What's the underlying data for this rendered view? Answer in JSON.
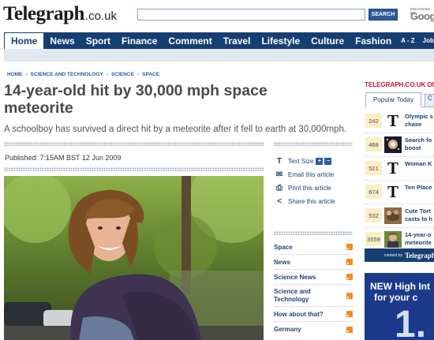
{
  "header": {
    "logo_main": "Telegraph",
    "logo_tld": ".co.uk",
    "search_button": "SEARCH",
    "google_enhanced": "ENHANCED BY",
    "google_logo": "Google"
  },
  "nav": {
    "items": [
      "Home",
      "News",
      "Sport",
      "Finance",
      "Comment",
      "Travel",
      "Lifestyle",
      "Culture",
      "Fashion",
      "A - Z",
      "Jobs"
    ],
    "active": "Home"
  },
  "breadcrumb": [
    "HOME",
    "SCIENCE AND TECHNOLOGY",
    "SCIENCE",
    "SPACE"
  ],
  "breadcrumb_sep": "›",
  "article": {
    "headline": "14-year-old hit by 30,000 mph space meteorite",
    "standfirst": "A schoolboy has survived a direct hit by a meteorite after it fell to earth at 30,000mph.",
    "published": "Published: 7:15AM BST 12 Jun 2009"
  },
  "tools": {
    "text_size": "Text Size",
    "text_plus": "+",
    "text_minus": "−",
    "email": "Email this article",
    "print": "Print this article",
    "share": "Share this article"
  },
  "topics": [
    "Space",
    "News",
    "Science News",
    "Science and Technology",
    "How about that?",
    "Germany"
  ],
  "right_column": {
    "title": "TELEGRAPH.CO.UK ON",
    "tab_active": "Popular Today",
    "tab_other": "C",
    "popular": [
      {
        "count": "242",
        "text": "Olympic s|chase",
        "thumb": "t"
      },
      {
        "count": "468",
        "text": "Search fo|boost",
        "thumb": "image"
      },
      {
        "count": "521",
        "text": "Woman K",
        "thumb": "t"
      },
      {
        "count": "674",
        "text": "Ten Place",
        "thumb": "t"
      },
      {
        "count": "532",
        "text": "Cute Tort|casts to h",
        "thumb": "image"
      },
      {
        "count": "3559",
        "text": "14-year-o|meteorite",
        "thumb": "image"
      }
    ],
    "content_by": "content by",
    "content_brand": "Telegraph",
    "ad_line1": "NEW High Int",
    "ad_line2": "for your c",
    "ad_big": "1."
  },
  "colors": {
    "nav_bg": "#163e73",
    "link": "#224477",
    "accent_red": "#c8102e",
    "rss": "#f08a24"
  }
}
